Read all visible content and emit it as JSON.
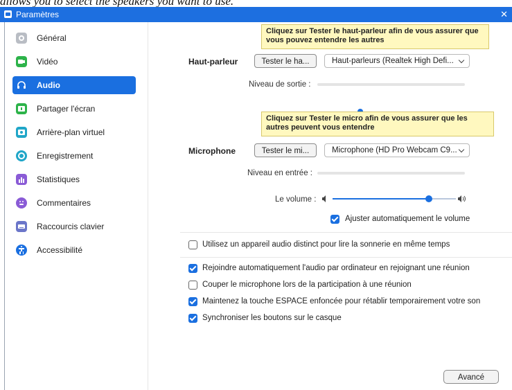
{
  "caption": "allows you to select the speakers you want to use.",
  "window": {
    "title": "Paramètres",
    "close_glyph": "✕"
  },
  "sidebar": {
    "items": [
      {
        "label": "Général",
        "icon": "gear-icon",
        "color": "#b9bdc4"
      },
      {
        "label": "Vidéo",
        "icon": "video-camera-icon",
        "color": "#2db34a"
      },
      {
        "label": "Audio",
        "icon": "headphones-icon",
        "color": "#1a6fe0",
        "active": true
      },
      {
        "label": "Partager l'écran",
        "icon": "share-screen-icon",
        "color": "#2db34a"
      },
      {
        "label": "Arrière-plan virtuel",
        "icon": "virtual-background-icon",
        "color": "#20a6c8"
      },
      {
        "label": "Enregistrement",
        "icon": "record-icon",
        "color": "#20a6c8"
      },
      {
        "label": "Statistiques",
        "icon": "stats-icon",
        "color": "#8a5bd6"
      },
      {
        "label": "Commentaires",
        "icon": "feedback-icon",
        "color": "#8a5bd6"
      },
      {
        "label": "Raccourcis clavier",
        "icon": "keyboard-icon",
        "color": "#6b76c9"
      },
      {
        "label": "Accessibilité",
        "icon": "accessibility-icon",
        "color": "#1a6fe0"
      }
    ]
  },
  "speaker": {
    "tooltip": "Cliquez sur Tester le haut-parleur afin de vous assurer que vous pouvez entendre les autres",
    "label": "Haut-parleur",
    "test_button": "Tester le ha...",
    "device": "Haut-parleurs (Realtek High Defi...",
    "output_level_label": "Niveau de sortie :"
  },
  "microphone": {
    "tooltip": "Cliquez sur Tester le micro afin de vous assurer que les autres peuvent vous entendre",
    "label": "Microphone",
    "test_button": "Tester le mi...",
    "device": "Microphone (HD Pro Webcam C9...",
    "input_level_label": "Niveau en entrée :",
    "volume_label": "Le volume :",
    "volume_level": 0.78,
    "auto_adjust": {
      "label": "Ajuster automatiquement le volume",
      "checked": true
    }
  },
  "options": [
    {
      "label": "Utilisez un appareil audio distinct pour lire la sonnerie en même temps",
      "checked": false
    },
    {
      "label": "Rejoindre automatiquement l'audio par ordinateur en rejoignant une réunion",
      "checked": true
    },
    {
      "label": "Couper le microphone lors de la participation à une réunion",
      "checked": false
    },
    {
      "label": "Maintenez la touche ESPACE enfoncée pour rétablir temporairement votre son",
      "checked": true
    },
    {
      "label": "Synchroniser les boutons sur le casque",
      "checked": true
    }
  ],
  "advanced_button": "Avancé",
  "colors": {
    "accent": "#1a6fe0",
    "titlebar": "#1d6fe0",
    "tooltip_bg": "#fff8bf"
  }
}
